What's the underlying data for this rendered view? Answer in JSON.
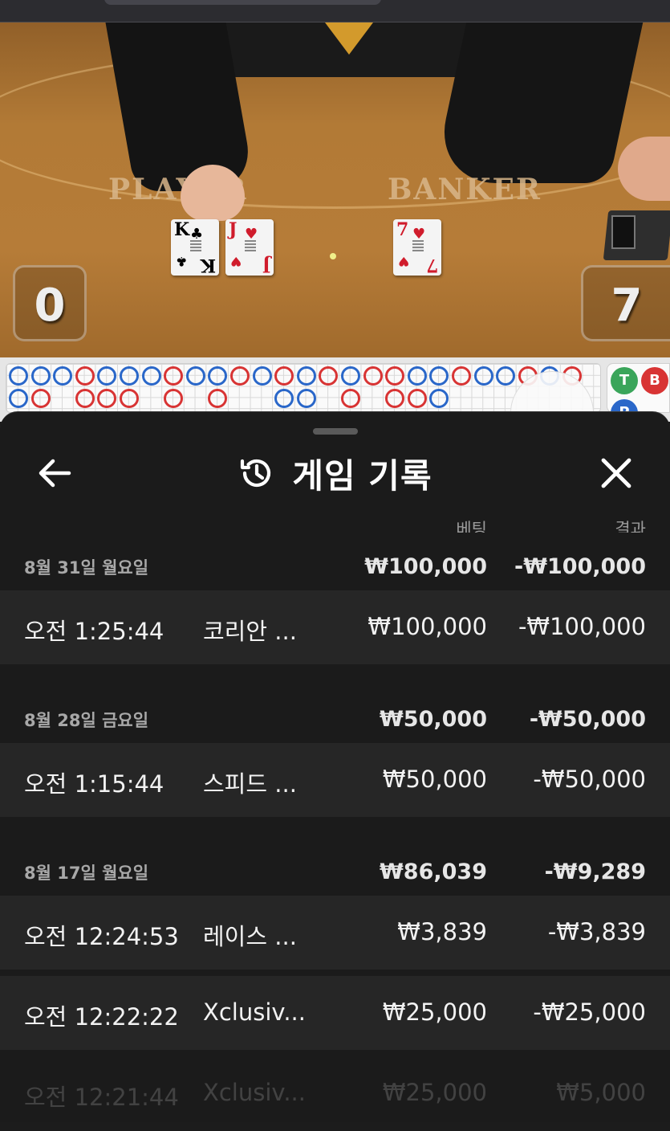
{
  "table": {
    "player_label": "PLAYER",
    "banker_label": "BANKER",
    "player_score": "0",
    "banker_score": "7",
    "player_cards": [
      {
        "rank": "K",
        "suit": "♣",
        "color": "#111111"
      },
      {
        "rank": "J",
        "suit": "♥",
        "color": "#d01c2c"
      }
    ],
    "banker_cards": [
      {
        "rank": "7",
        "suit": "♥",
        "color": "#d01c2c"
      }
    ],
    "side_chips": [
      {
        "label": "T",
        "color": "#3aa55a"
      },
      {
        "label": "B",
        "color": "#d83434"
      },
      {
        "label": "P",
        "color": "#2a67c9"
      }
    ]
  },
  "bead_road": {
    "top_row": [
      "P",
      "P",
      "P",
      "B",
      "P",
      "P",
      "P",
      "B",
      "P",
      "P",
      "B",
      "P",
      "B",
      "P",
      "B",
      "P",
      "B",
      "B",
      "P",
      "P",
      "B",
      "P",
      "P",
      "B",
      "P",
      "B"
    ],
    "bottom_row": [
      "P",
      "B",
      "",
      "B",
      "B",
      "B",
      "",
      "B",
      "",
      "B",
      "",
      "",
      "P",
      "P",
      "",
      "B",
      "",
      "B",
      "B",
      "P",
      "",
      "",
      "",
      "",
      "",
      ""
    ]
  },
  "sheet": {
    "title": "게임 기록",
    "back_icon": "arrow-left-icon",
    "history_icon": "history-icon",
    "close_icon": "close-icon",
    "col_bet": "베팅",
    "col_result": "결과",
    "groups": [
      {
        "date": "8월 31일 월요일",
        "bet_total": "₩100,000",
        "result_total": "-₩100,000",
        "items": [
          {
            "time": "오전 1:25:44",
            "game": "코리안 ...",
            "bet": "₩100,000",
            "result": "-₩100,000"
          }
        ]
      },
      {
        "date": "8월 28일 금요일",
        "bet_total": "₩50,000",
        "result_total": "-₩50,000",
        "items": [
          {
            "time": "오전 1:15:44",
            "game": "스피드 ...",
            "bet": "₩50,000",
            "result": "-₩50,000"
          }
        ]
      },
      {
        "date": "8월 17일 월요일",
        "bet_total": "₩86,039",
        "result_total": "-₩9,289",
        "items": [
          {
            "time": "오전 12:24:53",
            "game": "레이스 ...",
            "bet": "₩3,839",
            "result": "-₩3,839"
          },
          {
            "time": "오전 12:22:22",
            "game": "Xclusiv...",
            "bet": "₩25,000",
            "result": "-₩25,000"
          },
          {
            "time": "오전 12:21:44",
            "game": "Xclusiv...",
            "bet": "₩25,000",
            "result": "₩5,000"
          }
        ]
      }
    ]
  }
}
